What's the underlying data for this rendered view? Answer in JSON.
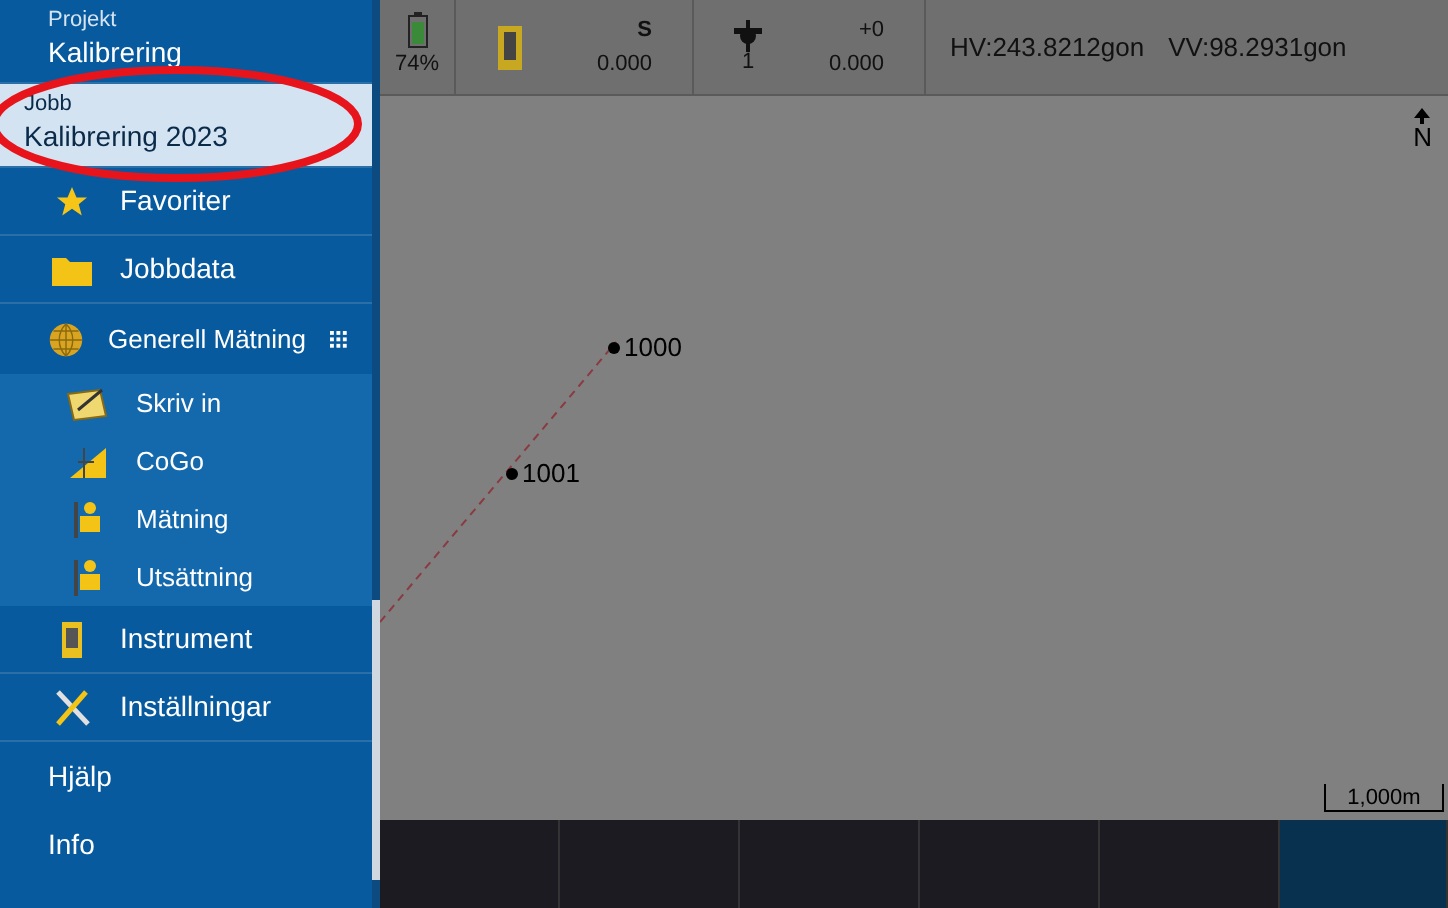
{
  "sidebar": {
    "project": {
      "label": "Projekt",
      "value": "Kalibrering"
    },
    "job": {
      "label": "Jobb",
      "value": "Kalibrering 2023",
      "selected": true
    },
    "items": [
      {
        "kind": "main",
        "label": "Favoriter"
      },
      {
        "kind": "main",
        "label": "Jobbdata"
      },
      {
        "kind": "group",
        "label": "Generell Mätning"
      },
      {
        "kind": "sub",
        "label": "Skriv in"
      },
      {
        "kind": "sub",
        "label": "CoGo"
      },
      {
        "kind": "sub",
        "label": "Mätning"
      },
      {
        "kind": "sub",
        "label": "Utsättning"
      },
      {
        "kind": "main",
        "label": "Instrument"
      },
      {
        "kind": "main",
        "label": "Inställningar"
      },
      {
        "kind": "text",
        "label": "Hjälp"
      },
      {
        "kind": "text",
        "label": "Info"
      }
    ]
  },
  "status_bar": {
    "battery": "74%",
    "instrument": {
      "face": "S",
      "value": "0.000"
    },
    "target": {
      "number": "1",
      "offset": "+0",
      "value": "0.000"
    },
    "hv": "HV:243.8212gon",
    "vv": "VV:98.2931gon"
  },
  "map": {
    "points": [
      {
        "label": "1000"
      },
      {
        "label": "1001"
      }
    ],
    "north": "N",
    "scale": "1,000m"
  },
  "softkeys": [
    {
      "selected": false
    },
    {
      "selected": false
    },
    {
      "selected": false
    },
    {
      "selected": false
    },
    {
      "selected": false
    },
    {
      "selected": true
    }
  ]
}
